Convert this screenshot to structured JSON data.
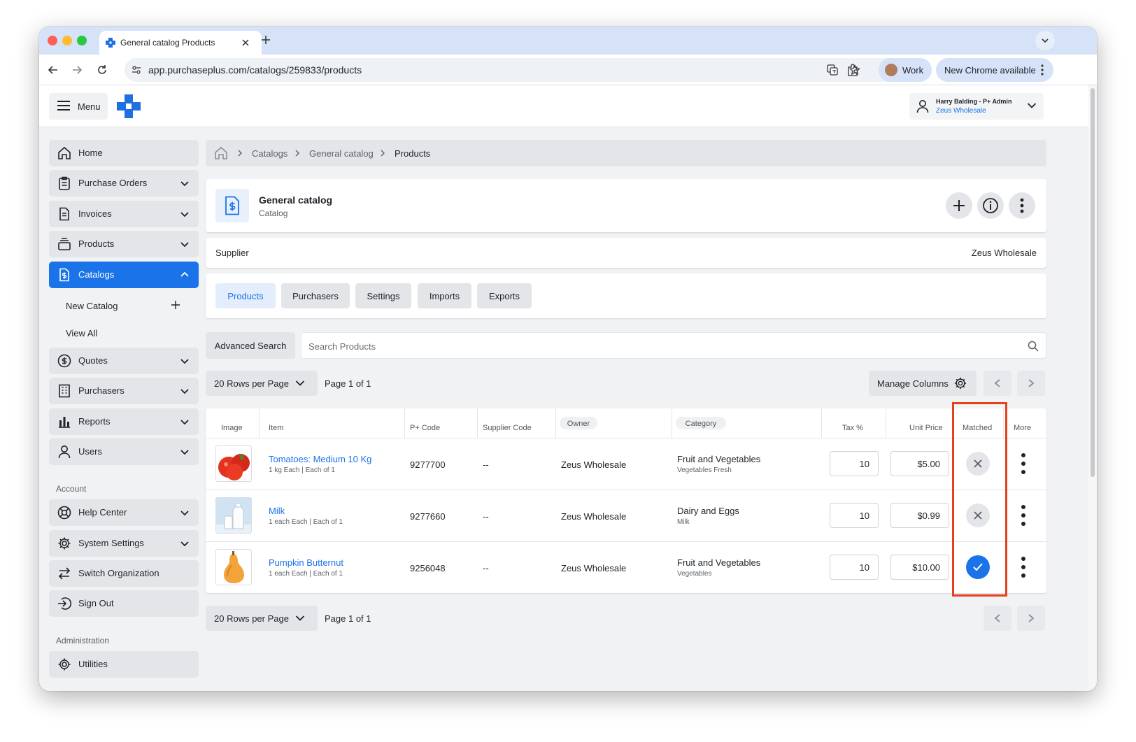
{
  "browser": {
    "tab_title": "General catalog Products",
    "url": "app.purchaseplus.com/catalogs/259833/products",
    "profile_label": "Work",
    "update_label": "New Chrome available"
  },
  "header": {
    "menu_label": "Menu",
    "user_name": "Harry Balding - P+ Admin",
    "org_name": "Zeus Wholesale"
  },
  "sidebar": {
    "items": [
      {
        "label": "Home"
      },
      {
        "label": "Purchase Orders"
      },
      {
        "label": "Invoices"
      },
      {
        "label": "Products"
      },
      {
        "label": "Catalogs"
      },
      {
        "label": "Quotes"
      },
      {
        "label": "Purchasers"
      },
      {
        "label": "Reports"
      },
      {
        "label": "Users"
      }
    ],
    "catalog_sub": {
      "new_catalog": "New Catalog",
      "view_all": "View All"
    },
    "account_heading": "Account",
    "account_items": [
      {
        "label": "Help Center"
      },
      {
        "label": "System Settings"
      },
      {
        "label": "Switch Organization"
      },
      {
        "label": "Sign Out"
      }
    ],
    "admin_heading": "Administration",
    "admin_items": [
      {
        "label": "Utilities"
      }
    ]
  },
  "breadcrumb": {
    "items": [
      "Catalogs",
      "General catalog",
      "Products"
    ]
  },
  "catalog": {
    "title": "General catalog",
    "subtitle": "Catalog",
    "supplier_label": "Supplier",
    "supplier_value": "Zeus Wholesale"
  },
  "tabs": [
    {
      "label": "Products"
    },
    {
      "label": "Purchasers"
    },
    {
      "label": "Settings"
    },
    {
      "label": "Imports"
    },
    {
      "label": "Exports"
    }
  ],
  "search": {
    "advanced_label": "Advanced Search",
    "placeholder": "Search Products"
  },
  "pagination": {
    "rows_label": "20 Rows per Page",
    "page_label": "Page 1 of 1",
    "manage_columns": "Manage Columns"
  },
  "table": {
    "columns": [
      "Image",
      "Item",
      "P+ Code",
      "Supplier Code",
      "Owner",
      "Category",
      "Tax %",
      "Unit Price",
      "Matched",
      "More"
    ],
    "rows": [
      {
        "name": "Tomatoes: Medium 10 Kg",
        "detail": "1 kg Each | Each of 1",
        "code": "9277700",
        "supplier_code": "--",
        "owner": "Zeus Wholesale",
        "category": "Fruit and Vegetables",
        "subcategory": "Vegetables Fresh",
        "tax": "10",
        "price": "$5.00",
        "matched": false,
        "image": "tomatoes-image"
      },
      {
        "name": "Milk",
        "detail": "1 each Each | Each of 1",
        "code": "9277660",
        "supplier_code": "--",
        "owner": "Zeus Wholesale",
        "category": "Dairy and Eggs",
        "subcategory": "Milk",
        "tax": "10",
        "price": "$0.99",
        "matched": false,
        "image": "milk-image"
      },
      {
        "name": "Pumpkin Butternut",
        "detail": "1 each Each | Each of 1",
        "code": "9256048",
        "supplier_code": "--",
        "owner": "Zeus Wholesale",
        "category": "Fruit and Vegetables",
        "subcategory": "Vegetables",
        "tax": "10",
        "price": "$10.00",
        "matched": true,
        "image": "pumpkin-image"
      }
    ]
  },
  "colors": {
    "accent": "#1a73e8",
    "highlight": "#e8401c",
    "brand": "#1f6fe0"
  }
}
